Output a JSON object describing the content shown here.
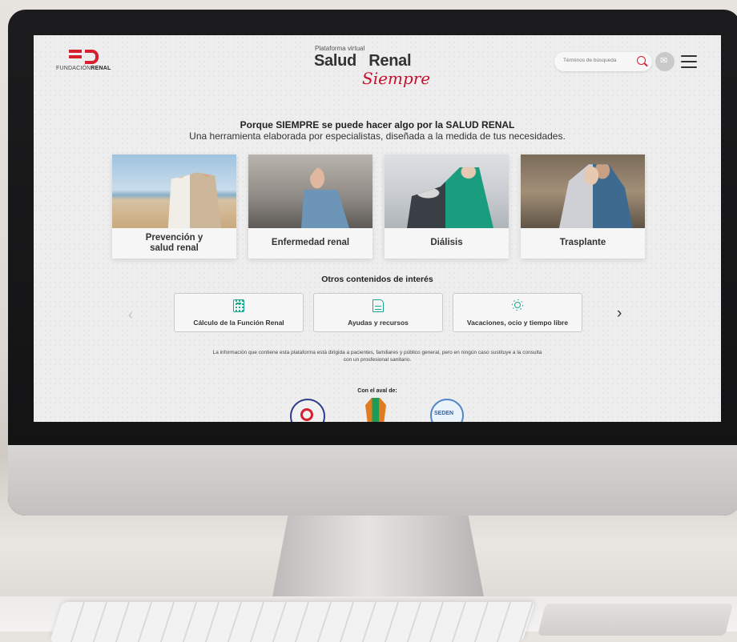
{
  "header": {
    "logo_text_light": "FUNDACIÓN",
    "logo_text_bold": "RENAL",
    "brand_sup": "Plataforma virtual",
    "brand_word1": "Salud",
    "brand_word2": "Renal",
    "brand_script": "Siempre",
    "search_placeholder": "Términos de búsqueda"
  },
  "hero": {
    "title": "Porque SIEMPRE se puede hacer algo por la SALUD RENAL",
    "subtitle": "Una herramienta elaborada por especialistas, diseñada a la medida de tus necesidades."
  },
  "cards": [
    {
      "label": "Prevención y\nsalud renal"
    },
    {
      "label": "Enfermedad renal"
    },
    {
      "label": "Diálisis"
    },
    {
      "label": "Trasplante"
    }
  ],
  "other": {
    "title": "Otros contenidos de interés",
    "items": [
      {
        "label": "Cálculo de la Función Renal",
        "icon": "calculator-icon"
      },
      {
        "label": "Ayudas y recursos",
        "icon": "document-icon"
      },
      {
        "label": "Vacaciones, ocio y tiempo libre",
        "icon": "sun-icon"
      }
    ],
    "prev_glyph": "‹",
    "next_glyph": "›"
  },
  "footer": {
    "disclaimer": "La información que contiene esta plataforma está dirigida a pacientes, familiares y público general, pero en ningún caso sustituye a la consulta con un prosfesional sanitario.",
    "aval_title": "Con el aval de:",
    "seal3_text": "SEDEN"
  },
  "colors": {
    "accent": "#d6202f",
    "teal": "#18a68c",
    "bezel": "#161617"
  }
}
